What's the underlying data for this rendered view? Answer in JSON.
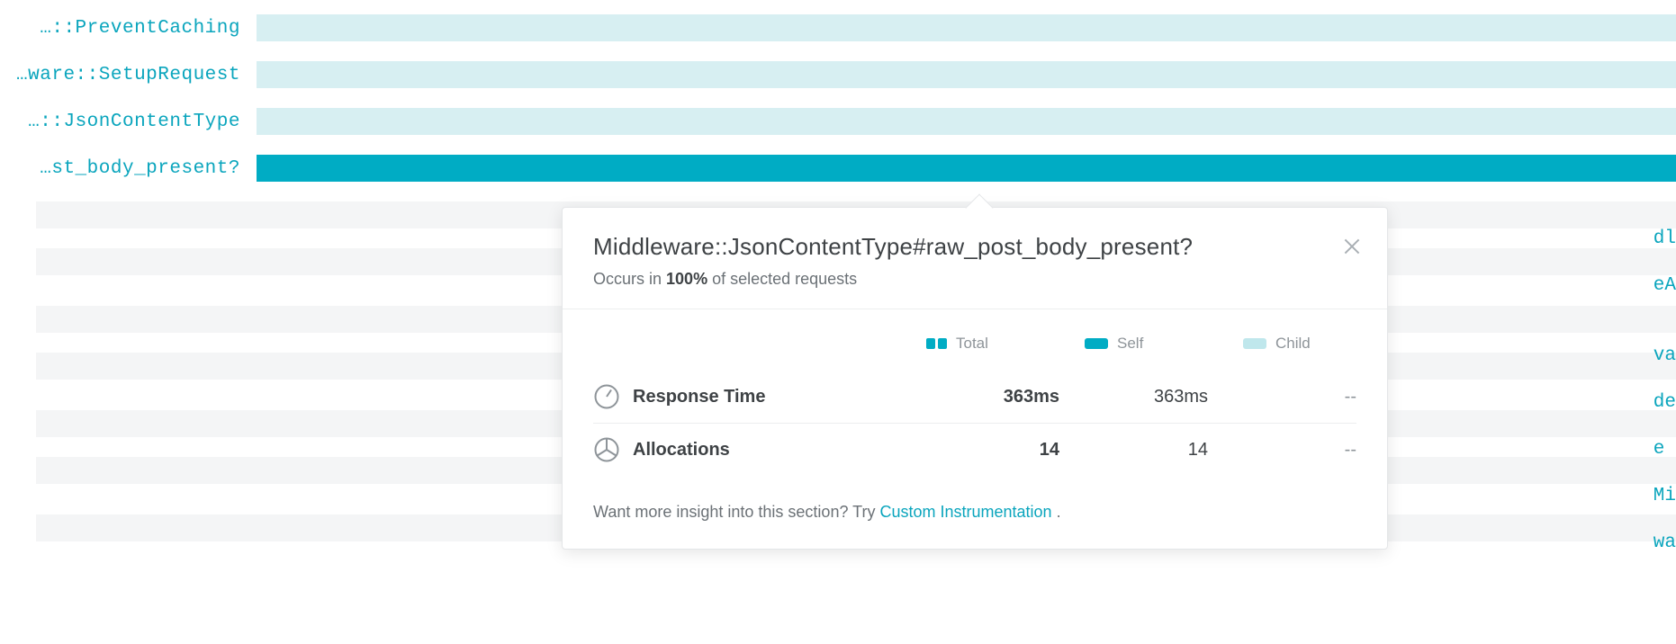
{
  "traces": [
    {
      "label": "…::PreventCaching",
      "variant": "light"
    },
    {
      "label": "…ware::SetupRequest",
      "variant": "light"
    },
    {
      "label": "…::JsonContentType",
      "variant": "light"
    },
    {
      "label": "…st_body_present?",
      "variant": "solid"
    }
  ],
  "obscured_labels": [
    "dl",
    "eA",
    "va",
    "de",
    "e",
    "Mi",
    "wa"
  ],
  "popover": {
    "title": "Middleware::JsonContentType#raw_post_body_present?",
    "occurs_prefix": "Occurs in ",
    "occurs_percent": "100%",
    "occurs_suffix": " of selected requests",
    "legend": {
      "total": "Total",
      "self": "Self",
      "child": "Child"
    },
    "metrics": [
      {
        "icon": "gauge",
        "name": "Response Time",
        "total": "363ms",
        "self": "363ms",
        "child": "--"
      },
      {
        "icon": "pie",
        "name": "Allocations",
        "total": "14",
        "self": "14",
        "child": "--"
      }
    ],
    "footer_prefix": "Want more insight into this section? Try ",
    "footer_link": "Custom Instrumentation",
    "footer_suffix": " ."
  }
}
